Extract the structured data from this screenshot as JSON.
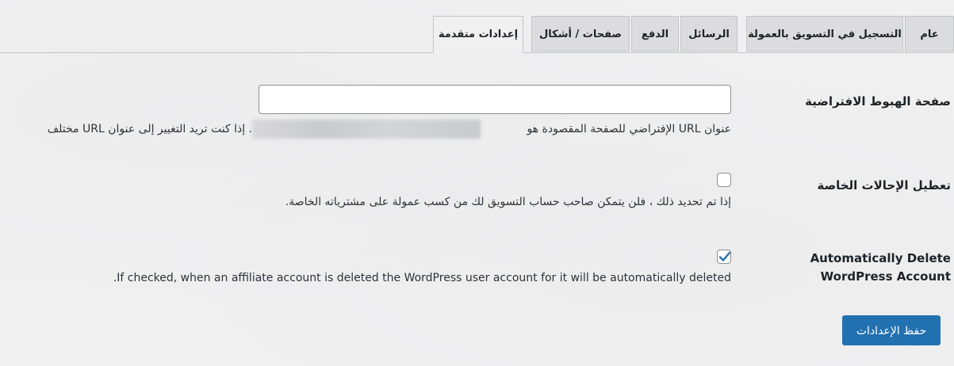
{
  "tabs": [
    {
      "label": "عام"
    },
    {
      "label": "التسجيل في التسويق بالعمولة"
    },
    {
      "label": "الرسائل"
    },
    {
      "label": "الدفع"
    },
    {
      "label": "صفحات / أشكال"
    },
    {
      "label": "إعدادات متقدمة"
    }
  ],
  "active_tab": "إعدادات متقدمة",
  "landing_page": {
    "label": "صفحة الهبوط الافتراضية",
    "input_value": "",
    "description_start": "عنوان URL الإفتراضي للصفحة المقصودة هو",
    "description_end": ". إذا كنت تريد التغيير إلى عنوان URL مختلف"
  },
  "disable_self_referrals": {
    "label": "تعطيل الإحالات الخاصة",
    "checked": false,
    "description": "إذا تم تحديد ذلك ، فلن يتمكن صاحب حساب التسويق لك من كسب عمولة على مشترياته الخاصة."
  },
  "auto_delete": {
    "label_line1": "Automatically Delete",
    "label_line2": "WordPress Account",
    "checked": true,
    "description": ".If checked, when an affiliate account is deleted the WordPress user account for it will be automatically deleted"
  },
  "save_button": {
    "label": "حفظ الإعدادات"
  },
  "colors": {
    "primary": "#2271b1",
    "tab_inactive": "#dcdcde",
    "background": "#f0f0f1",
    "text": "#1d2327"
  }
}
